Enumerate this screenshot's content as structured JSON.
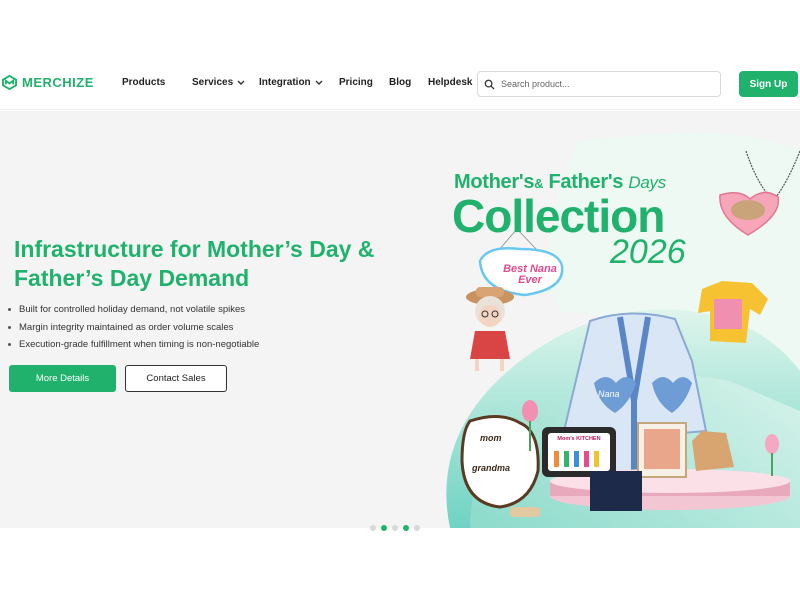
{
  "brand": {
    "name": "MERCHIZE",
    "color": "#20b26c"
  },
  "nav": {
    "items": [
      {
        "label": "Products",
        "dropdown": false
      },
      {
        "label": "Services",
        "dropdown": true
      },
      {
        "label": "Integration",
        "dropdown": true
      },
      {
        "label": "Pricing",
        "dropdown": false
      },
      {
        "label": "Blog",
        "dropdown": false
      },
      {
        "label": "Helpdesk",
        "dropdown": false
      }
    ],
    "chevron": "⌄"
  },
  "search": {
    "placeholder": "Search product...",
    "value": "",
    "icon": "search-icon"
  },
  "signup_label": "Sign Up",
  "hero": {
    "title": "Infrastructure for Mother’s Day & Father’s Day Demand",
    "bullets": [
      "Built for controlled holiday demand, not volatile spikes",
      "Margin integrity maintained as order volume scales",
      "Execution-grade fulfillment when timing is non-negotiable"
    ],
    "primary_button": "More Details",
    "secondary_button": "Contact Sales"
  },
  "banner": {
    "line1_a": "Mother's",
    "line1_amp": "&",
    "line1_b": "Father's",
    "line1_days": "Days",
    "line2": "Collection",
    "line3": "2026",
    "ornament_text": "Best Nana Ever",
    "cardigan_text": "Nana",
    "kitchen_text": "Mom's KITCHEN",
    "board_text_top": "mom",
    "board_text_bottom": "grandma"
  },
  "carousel": {
    "count": 5,
    "active": [
      1,
      3
    ]
  }
}
